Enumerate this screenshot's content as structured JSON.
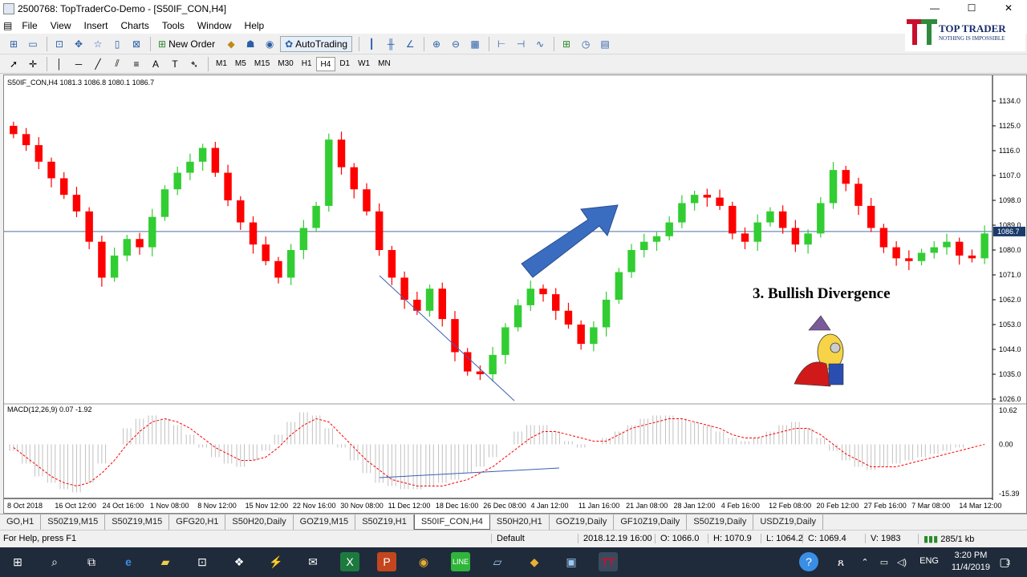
{
  "window": {
    "title": "2500768: TopTraderCo-Demo - [S50IF_CON,H4]",
    "minimize": "—",
    "close": "✕"
  },
  "menu": [
    "File",
    "View",
    "Insert",
    "Charts",
    "Tools",
    "Window",
    "Help"
  ],
  "toolbar": {
    "new_order": "New Order",
    "autotrading": "AutoTrading"
  },
  "timeframes": [
    "M1",
    "M5",
    "M15",
    "M30",
    "H1",
    "H4",
    "D1",
    "W1",
    "MN"
  ],
  "active_timeframe": "H4",
  "logo": {
    "name": "TOP TRADER",
    "tagline": "NOTHING IS IMPOSSIBLE",
    "colors": {
      "t1": "#c8102e",
      "t2": "#2e8b3c"
    }
  },
  "chart": {
    "symbol_info": "S50IF_CON,H4  1081.3 1086.8 1080.1 1086.7",
    "macd_info": "MACD(12,26,9) 0.07 -1.92",
    "current_price": "1086.7",
    "annotation": "3. Bullish Divergence",
    "colors": {
      "up": "#32cd32",
      "down": "#ff0000",
      "price_line": "#4a6fa5",
      "signal": "#ff0000",
      "histogram": "#c0c0c0",
      "arrow": "#3a6dc0"
    }
  },
  "chart_data": {
    "type": "line",
    "title": "",
    "xlabel": "",
    "ylabel": "",
    "ylim": [
      1026.0,
      1134.0
    ],
    "y_ticks": [
      "1134.0",
      "1125.0",
      "1116.0",
      "1107.0",
      "1098.0",
      "1089.0",
      "1080.0",
      "1071.0",
      "1062.0",
      "1053.0",
      "1044.0",
      "1035.0",
      "1026.0"
    ],
    "x_ticks": [
      "8 Oct 2018",
      "16 Oct 12:00",
      "24 Oct 16:00",
      "1 Nov 08:00",
      "8 Nov 12:00",
      "15 Nov 12:00",
      "22 Nov 16:00",
      "30 Nov 08:00",
      "11 Dec 12:00",
      "18 Dec 16:00",
      "26 Dec 08:00",
      "4 Jan 12:00",
      "11 Jan 16:00",
      "21 Jan 08:00",
      "28 Jan 12:00",
      "4 Feb 16:00",
      "12 Feb 08:00",
      "20 Feb 12:00",
      "27 Feb 16:00",
      "7 Mar 08:00",
      "14 Mar 12:00"
    ],
    "series": [
      {
        "name": "",
        "values": [
          1122,
          1118,
          1112,
          1106,
          1100,
          1094,
          1083,
          1070,
          1078,
          1084,
          1081,
          1092,
          1102,
          1108,
          1112,
          1117,
          1108,
          1098,
          1090,
          1082,
          1076,
          1070,
          1080,
          1088,
          1096,
          1120,
          1110,
          1102,
          1094,
          1080,
          1070,
          1062,
          1058,
          1066,
          1055,
          1043,
          1036,
          1035,
          1042,
          1052,
          1060,
          1066,
          1064,
          1058,
          1053,
          1046,
          1052,
          1062,
          1072,
          1080,
          1083,
          1085,
          1090,
          1097,
          1100,
          1099,
          1096,
          1086,
          1083,
          1090,
          1094,
          1088,
          1082,
          1086,
          1097,
          1109,
          1104,
          1096,
          1088,
          1081,
          1077,
          1076,
          1079,
          1081,
          1083,
          1078,
          1077,
          1086
        ]
      }
    ],
    "macd": {
      "ylim": [
        -15.39,
        10.62
      ],
      "y_ticks": [
        "10.62",
        "0.00",
        "-15.39"
      ],
      "histogram": [
        -2,
        -6,
        -10,
        -12,
        -14,
        -15,
        -12,
        -6,
        0,
        5,
        8,
        9,
        8,
        6,
        3,
        -1,
        -4,
        -6,
        -7,
        -5,
        -2,
        3,
        7,
        10,
        9,
        5,
        -1,
        -5,
        -9,
        -12,
        -13,
        -14,
        -14,
        -13,
        -12,
        -11,
        -9,
        -7,
        -4,
        0,
        4,
        6,
        6,
        4,
        1,
        -1,
        0,
        2,
        4,
        6,
        8,
        9,
        9,
        8,
        7,
        6,
        4,
        2,
        1,
        2,
        4,
        6,
        7,
        5,
        2,
        -2,
        -5,
        -7,
        -8,
        -7,
        -6,
        -5,
        -4,
        -3,
        -2,
        -1,
        0,
        0
      ],
      "signal": [
        -1,
        -4,
        -7,
        -10,
        -12,
        -13,
        -12,
        -9,
        -5,
        0,
        4,
        7,
        8,
        7,
        5,
        2,
        -1,
        -3,
        -5,
        -5,
        -4,
        -1,
        3,
        6,
        8,
        7,
        3,
        -1,
        -5,
        -8,
        -11,
        -12,
        -13,
        -13,
        -13,
        -12,
        -11,
        -9,
        -7,
        -4,
        -1,
        2,
        4,
        4,
        3,
        2,
        1,
        1,
        3,
        5,
        6,
        7,
        8,
        8,
        7,
        6,
        5,
        3,
        2,
        2,
        3,
        4,
        5,
        5,
        3,
        0,
        -3,
        -5,
        -7,
        -7,
        -7,
        -6,
        -5,
        -4,
        -3,
        -2,
        -1,
        0
      ]
    }
  },
  "tabs": [
    "GO,H1",
    "S50Z19,M15",
    "S50Z19,M15",
    "GFG20,H1",
    "S50H20,Daily",
    "GOZ19,M15",
    "S50Z19,H1",
    "S50IF_CON,H4",
    "S50H20,H1",
    "GOZ19,Daily",
    "GF10Z19,Daily",
    "S50Z19,Daily",
    "USDZ19,Daily"
  ],
  "active_tab": "S50IF_CON,H4",
  "status": {
    "help": "For Help, press F1",
    "profile": "Default",
    "time": "2018.12.19 16:00",
    "open": "O: 1066.0",
    "high": "H: 1070.9",
    "low": "L: 1064.2",
    "close": "C: 1069.4",
    "volume": "V: 1983",
    "traffic": "285/1 kb"
  },
  "taskbar": {
    "lang": "ENG",
    "time": "3:20 PM",
    "date": "11/4/2019",
    "notifications": "3"
  }
}
